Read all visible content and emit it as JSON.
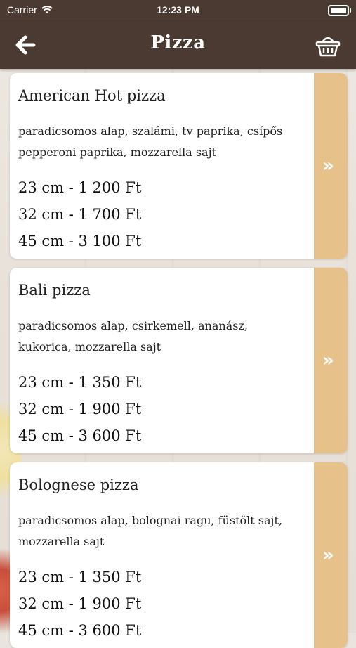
{
  "status": {
    "carrier": "Carrier",
    "time": "12:23 PM"
  },
  "header": {
    "title": "Pizza"
  },
  "icons": {
    "back": "arrow-left-icon",
    "cart": "basket-icon",
    "more": "double-chevron-right-icon"
  },
  "colors": {
    "header_bg": "#4b3a32",
    "accent_tab": "#e6c28a"
  },
  "items": [
    {
      "name": "American Hot pizza",
      "description": "paradicsomos alap, szalámi, tv paprika, csípős pepperoni paprika, mozzarella  sajt",
      "prices": [
        "23 cm - 1 200 Ft",
        "32 cm - 1 700 Ft",
        "45 cm - 3 100 Ft"
      ]
    },
    {
      "name": "Bali pizza",
      "description": "paradicsomos alap, csirkemell, ananász, kukorica, mozzarella  sajt",
      "prices": [
        "23 cm - 1 350 Ft",
        "32 cm - 1 900 Ft",
        "45 cm - 3 600 Ft"
      ]
    },
    {
      "name": "Bolognese pizza",
      "description": "paradicsomos alap, bolognai ragu, füstölt sajt, mozzarella  sajt",
      "prices": [
        "23 cm - 1 350 Ft",
        "32 cm - 1 900 Ft",
        "45 cm - 3 600 Ft"
      ]
    }
  ]
}
